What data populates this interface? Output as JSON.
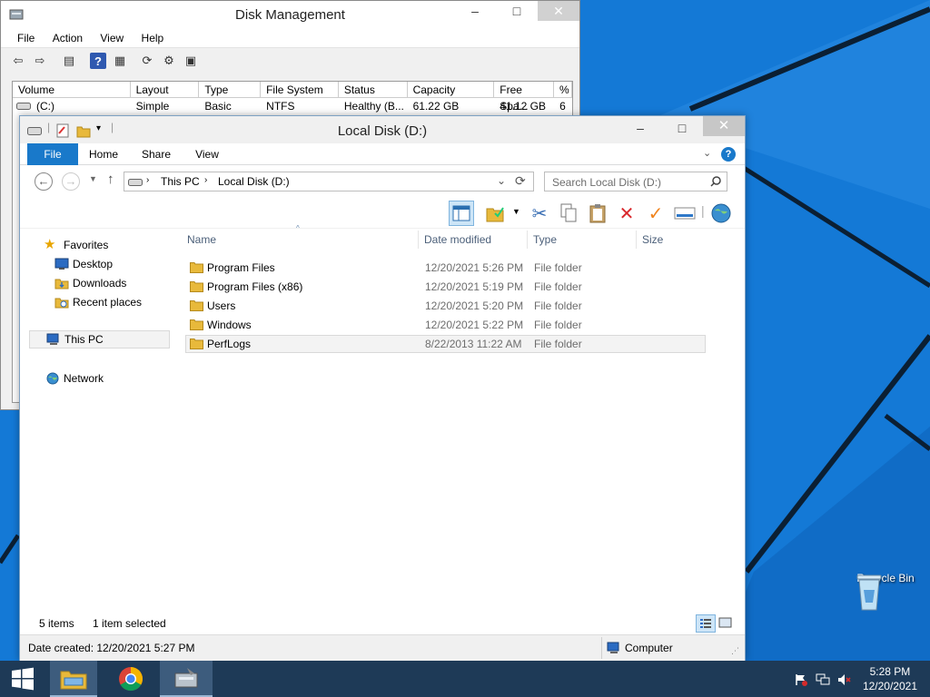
{
  "colors": {
    "desktop": "#1479d6",
    "accent": "#1979ca",
    "taskbar": "#1e3a57"
  },
  "disk_management": {
    "title": "Disk Management",
    "menu": [
      "File",
      "Action",
      "View",
      "Help"
    ],
    "columns": [
      "Volume",
      "Layout",
      "Type",
      "File System",
      "Status",
      "Capacity",
      "Free Spa...",
      "%"
    ],
    "rows": [
      {
        "volume": "(C:)",
        "layout": "Simple",
        "type": "Basic",
        "fs": "NTFS",
        "status": "Healthy (B...",
        "capacity": "61.22 GB",
        "free": "41.12 GB",
        "pct": "6"
      }
    ]
  },
  "explorer": {
    "title": "Local Disk (D:)",
    "ribbon_tabs": [
      "File",
      "Home",
      "Share",
      "View"
    ],
    "address": {
      "this_pc": "This PC",
      "current": "Local Disk (D:)"
    },
    "search_placeholder": "Search Local Disk (D:)",
    "nav": {
      "favorites": "Favorites",
      "desktop": "Desktop",
      "downloads": "Downloads",
      "recent": "Recent places",
      "this_pc": "This PC",
      "network": "Network"
    },
    "columns": {
      "name": "Name",
      "date": "Date modified",
      "type": "Type",
      "size": "Size"
    },
    "files": [
      {
        "name": "Program Files",
        "date": "12/20/2021 5:26 PM",
        "type": "File folder"
      },
      {
        "name": "Program Files (x86)",
        "date": "12/20/2021 5:19 PM",
        "type": "File folder"
      },
      {
        "name": "Users",
        "date": "12/20/2021 5:20 PM",
        "type": "File folder"
      },
      {
        "name": "Windows",
        "date": "12/20/2021 5:22 PM",
        "type": "File folder"
      },
      {
        "name": "PerfLogs",
        "date": "8/22/2013 11:22 AM",
        "type": "File folder"
      }
    ],
    "status": {
      "items": "5 items",
      "selected": "1 item selected"
    },
    "details_left": "Date created: 12/20/2021 5:27 PM",
    "details_right": "Computer"
  },
  "desktop": {
    "recycle_bin": "Recycle Bin"
  },
  "taskbar": {
    "time": "5:28 PM",
    "date": "12/20/2021"
  }
}
